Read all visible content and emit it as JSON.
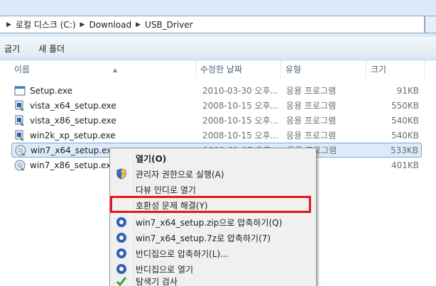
{
  "address": {
    "crumbs": [
      "로컬 디스크 (C:)",
      "Download",
      "USB_Driver"
    ]
  },
  "toolbar": {
    "items": [
      "굽기",
      "새 폴더"
    ]
  },
  "columns": {
    "name": "이름",
    "date": "수정한 날짜",
    "type": "유형",
    "size": "크기"
  },
  "files": [
    {
      "name": "Setup.exe",
      "date": "2010-03-30 오후...",
      "type": "응용 프로그램",
      "size": "91KB",
      "icon": "application-icon"
    },
    {
      "name": "vista_x64_setup.exe",
      "date": "2008-10-15 오후...",
      "type": "응용 프로그램",
      "size": "550KB",
      "icon": "installer-icon"
    },
    {
      "name": "vista_x86_setup.exe",
      "date": "2008-10-15 오후...",
      "type": "응용 프로그램",
      "size": "540KB",
      "icon": "installer-icon"
    },
    {
      "name": "win2k_xp_setup.exe",
      "date": "2008-10-15 오후...",
      "type": "응용 프로그램",
      "size": "540KB",
      "icon": "installer-icon"
    },
    {
      "name": "win7_x64_setup.exe",
      "date": "2010-01-05 오후...",
      "type": "응용 프로그램",
      "size": "533KB",
      "icon": "cd-installer-icon",
      "selected": true
    },
    {
      "name": "win7_x86_setup.exe",
      "date": "",
      "type": "",
      "size": "401KB",
      "icon": "cd-installer-icon"
    }
  ],
  "context_menu": {
    "open": "열기(O)",
    "run_as_admin": "관리자 권한으로 실행(A)",
    "open_in_daum": "다뷰 인디로 열기",
    "troubleshoot": "호환성 문제 해결(Y)",
    "compress_zip": "win7_x64_setup.zip으로 압축하기(Q)",
    "compress_7z": "win7_x64_setup.7z로 압축하기(7)",
    "compress_bandizip": "반디집으로 압축하기(L)...",
    "open_bandizip": "반디집으로 열기",
    "scan_explorer": "탐색기 검사"
  },
  "colors": {
    "highlight": "#e8141c",
    "selection": "#dcebfc"
  }
}
